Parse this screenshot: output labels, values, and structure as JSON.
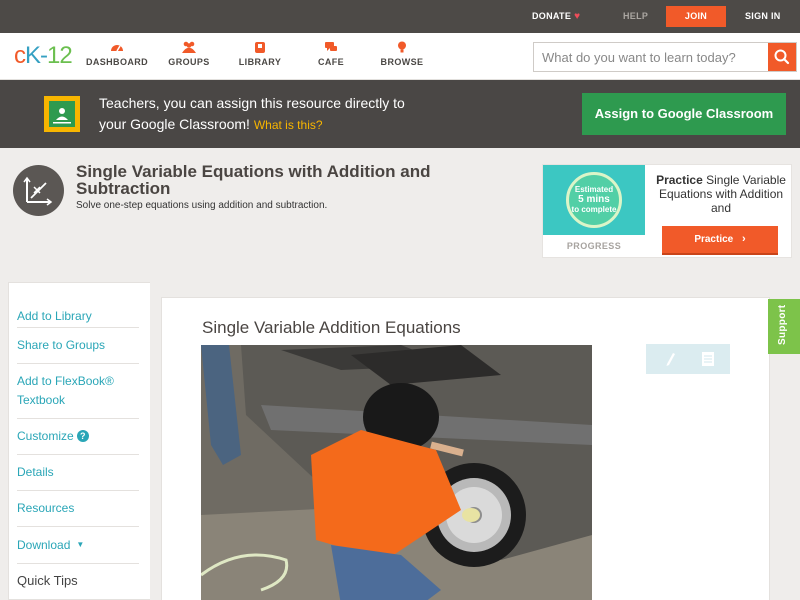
{
  "topbar": {
    "donate": "DONATE",
    "help": "HELP",
    "join": "JOIN",
    "signin": "SIGN IN",
    "accent": "#f15a29"
  },
  "nav": {
    "logo": {
      "c": "c",
      "k": "K-",
      "n": "12"
    },
    "items": [
      {
        "label": "DASHBOARD",
        "icon": "dashboard-icon"
      },
      {
        "label": "GROUPS",
        "icon": "groups-icon"
      },
      {
        "label": "LIBRARY",
        "icon": "library-icon"
      },
      {
        "label": "CAFE",
        "icon": "cafe-icon"
      },
      {
        "label": "BROWSE",
        "icon": "browse-icon"
      }
    ],
    "search_placeholder": "What do you want to learn today?"
  },
  "classroom_banner": {
    "line1": "Teachers, you can assign this resource directly to",
    "line2": "your Google Classroom!",
    "what": "What is this?",
    "button": "Assign to Google Classroom"
  },
  "header": {
    "title": "Single Variable Equations with Addition and Subtraction",
    "subtitle": "Solve one-step equations using addition and subtraction."
  },
  "practice": {
    "estimated": "Estimated",
    "mins": "5 mins",
    "to_complete": "to complete",
    "progress": "PROGRESS",
    "title_bold": "Practice",
    "title_rest": "Single Variable Equations with Addition and",
    "button": "Practice"
  },
  "sidebar": {
    "items": [
      {
        "label": "Add to Library"
      },
      {
        "label": "Share to Groups"
      },
      {
        "label": "Add to FlexBook® Textbook"
      },
      {
        "label": "Customize"
      },
      {
        "label": "Details"
      },
      {
        "label": "Resources"
      },
      {
        "label": "Download"
      }
    ],
    "quick_tips": "Quick Tips"
  },
  "content": {
    "title": "Single Variable Addition Equations"
  },
  "support": "Support"
}
